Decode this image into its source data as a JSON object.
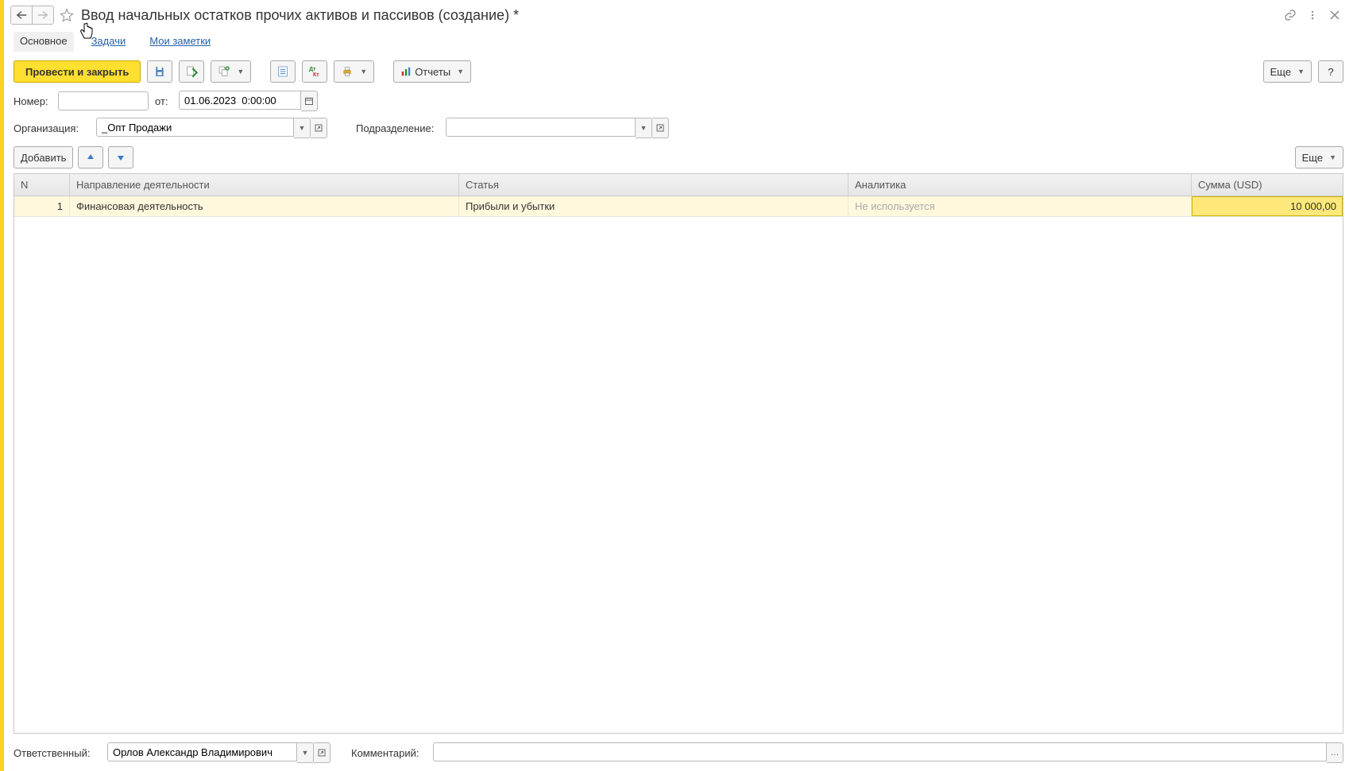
{
  "title": "Ввод начальных остатков прочих активов и пассивов (создание) *",
  "tabs": {
    "main": "Основное",
    "tasks": "Задачи",
    "notes": "Мои заметки"
  },
  "toolbar": {
    "post_close": "Провести и закрыть",
    "reports": "Отчеты",
    "more": "Еще",
    "help": "?"
  },
  "form": {
    "number_label": "Номер:",
    "number_value": "",
    "from_label": "от:",
    "date_value": "01.06.2023  0:00:00",
    "org_label": "Организация:",
    "org_value": "_Опт Продажи",
    "dept_label": "Подразделение:",
    "dept_value": ""
  },
  "tableToolbar": {
    "add": "Добавить",
    "more": "Еще"
  },
  "table": {
    "headers": {
      "n": "N",
      "direction": "Направление деятельности",
      "article": "Статья",
      "analytics": "Аналитика",
      "sum": "Сумма (USD)"
    },
    "rows": [
      {
        "n": "1",
        "direction": "Финансовая деятельность",
        "article": "Прибыли и убытки",
        "analytics": "Не используется",
        "sum": "10 000,00"
      }
    ]
  },
  "footer": {
    "responsible_label": "Ответственный:",
    "responsible_value": "Орлов Александр Владимирович",
    "comment_label": "Комментарий:",
    "comment_value": ""
  }
}
